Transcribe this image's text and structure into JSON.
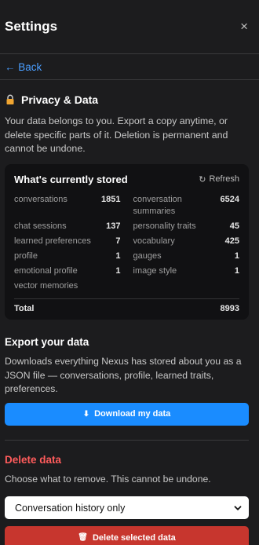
{
  "header": {
    "title": "Settings",
    "close_glyph": "×"
  },
  "nav": {
    "back_label": "← Back"
  },
  "privacy": {
    "title": "Privacy & Data",
    "icon": "lock-icon",
    "intro": "Your data belongs to you. Export a copy anytime, or delete specific parts of it. Deletion is permanent and cannot be undone."
  },
  "stored": {
    "title": "What's currently stored",
    "refresh_label": "Refresh",
    "refresh_glyph": "↻",
    "left": [
      {
        "label": "conversations",
        "value": "1851"
      },
      {
        "label": "chat sessions",
        "value": "137"
      },
      {
        "label": "learned preferences",
        "value": "7"
      },
      {
        "label": "profile",
        "value": "1"
      },
      {
        "label": "emotional profile",
        "value": "1"
      },
      {
        "label": "vector memories",
        "value": ""
      }
    ],
    "right": [
      {
        "label": "conversation summaries",
        "value": "6524"
      },
      {
        "label": "personality traits",
        "value": "45"
      },
      {
        "label": "vocabulary",
        "value": "425"
      },
      {
        "label": "gauges",
        "value": "1"
      },
      {
        "label": "image style",
        "value": "1"
      }
    ],
    "total_label": "Total",
    "total_value": "8993"
  },
  "export": {
    "title": "Export your data",
    "description": "Downloads everything Nexus has stored about you as a JSON file — conversations, profile, learned traits, preferences.",
    "button_label": "Download my data",
    "button_glyph": "⬇"
  },
  "delete": {
    "title": "Delete data",
    "description": "Choose what to remove. This cannot be undone.",
    "selected_option": "Conversation history only",
    "button_label": "Delete selected data",
    "button_glyph": "🗑"
  },
  "colors": {
    "background": "#1c1c1e",
    "accent": "#1a8cff",
    "link": "#4a9eff",
    "danger_text": "#ff5c5c",
    "danger_button": "#c7362e",
    "card": "#111113"
  }
}
